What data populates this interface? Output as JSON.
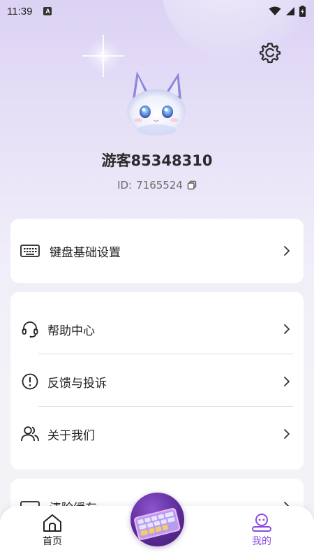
{
  "status_bar": {
    "time": "11:39",
    "badge": "A"
  },
  "profile": {
    "username": "游客85348310",
    "id_label": "ID:",
    "id_value": "7165524"
  },
  "menu": {
    "keyboard_settings": "键盘基础设置",
    "help_center": "帮助中心",
    "feedback": "反馈与投诉",
    "about_us": "关于我们",
    "clear_cache": "清除缓存"
  },
  "tabbar": {
    "home_label": "首页",
    "mine_label": "我的"
  },
  "colors": {
    "accent": "#8b4be2",
    "card_bg": "#ffffff"
  },
  "icons": {
    "settings": "settings-gear-icon",
    "keyboard": "keyboard-icon",
    "headset": "headset-icon",
    "alert": "alert-circle-icon",
    "users": "users-icon",
    "copy": "copy-icon",
    "home": "home-icon",
    "mine": "robot-face-icon"
  }
}
